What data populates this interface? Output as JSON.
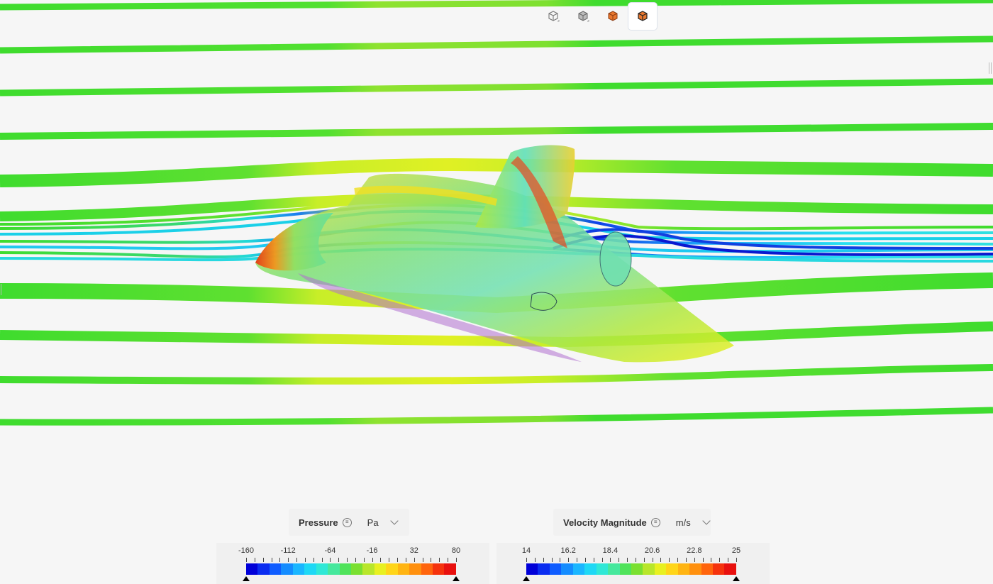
{
  "view_toolbar": {
    "buttons": [
      {
        "name": "wireframe-view-icon"
      },
      {
        "name": "solid-view-icon"
      },
      {
        "name": "surface-colored-view-icon"
      },
      {
        "name": "surface-edges-view-icon",
        "active": true
      }
    ]
  },
  "legends": [
    {
      "id": "pressure",
      "title": "Pressure",
      "unit": "Pa",
      "ticks": [
        "-160",
        "-112",
        "-64",
        "-16",
        "32",
        "80"
      ]
    },
    {
      "id": "velocity",
      "title": "Velocity Magnitude",
      "unit": "m/s",
      "ticks": [
        "14",
        "16.2",
        "18.4",
        "20.6",
        "22.8",
        "25"
      ]
    }
  ],
  "colormap": [
    "#0000d8",
    "#0a2cf0",
    "#0f5cff",
    "#148cff",
    "#1ab6ff",
    "#1ed8f5",
    "#2fe8d6",
    "#45e89d",
    "#4fe35a",
    "#7ae030",
    "#b8e62a",
    "#e8f020",
    "#ffd518",
    "#ffb412",
    "#ff900e",
    "#ff640c",
    "#f5320c",
    "#e8100e"
  ]
}
